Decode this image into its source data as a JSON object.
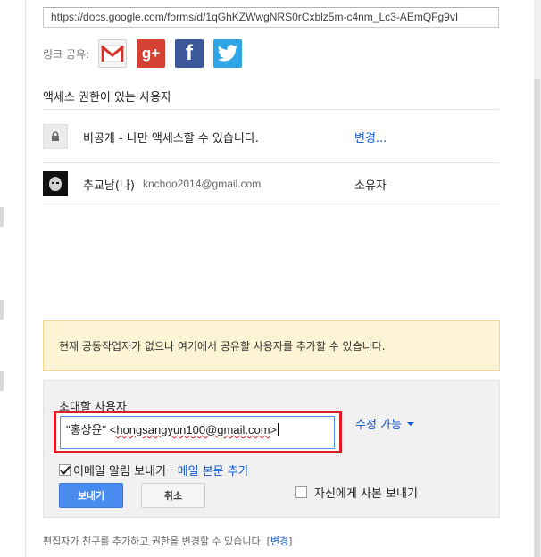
{
  "share_dialog": {
    "link_url": "https://docs.google.com/forms/d/1qGhKZWwgNRS0rCxblz5m-c4nm_Lc3-AEmQFg9vI",
    "share_label": "링크 공유:",
    "share_icons": [
      "gmail-icon",
      "google-plus-icon",
      "facebook-icon",
      "twitter-icon"
    ],
    "access_section_title": "액세스 권한이 있는 사용자",
    "visibility": {
      "text": "비공개 - 나만 액세스할 수 있습니다.",
      "change_link": "변경..."
    },
    "owner": {
      "name": "추교남(나)",
      "email": "knchoo2014@gmail.com",
      "role": "소유자"
    },
    "notice": "현재 공동작업자가 없으나 여기에서 공유할 사용자를 추가할 수 있습니다.",
    "invite": {
      "label": "초대할 사용자",
      "value_name": "\"홍상윤\"",
      "value_email_open": "<",
      "value_email": "hongsangyun100@gmail.com",
      "value_email_close": ">",
      "permission": "수정 가능",
      "notify_label": "이메일 알림 보내기",
      "notify_sep": "-",
      "add_message_link": "메일 본문 추가",
      "notify_checked": true,
      "send_button": "보내기",
      "cancel_button": "취소",
      "send_copy_label": "자신에게 사본 보내기",
      "send_copy_checked": false
    },
    "footer": {
      "text": "편집자가 친구를 추가하고 권한을 변경할 수 있습니다.",
      "bracket_open": "[",
      "link": "변경",
      "bracket_close": "]"
    },
    "colors": {
      "link": "#1155cc",
      "notice_bg": "#fcf4d4",
      "send_button": "#4a8bf0",
      "highlight_frame": "#dd1c28"
    }
  }
}
